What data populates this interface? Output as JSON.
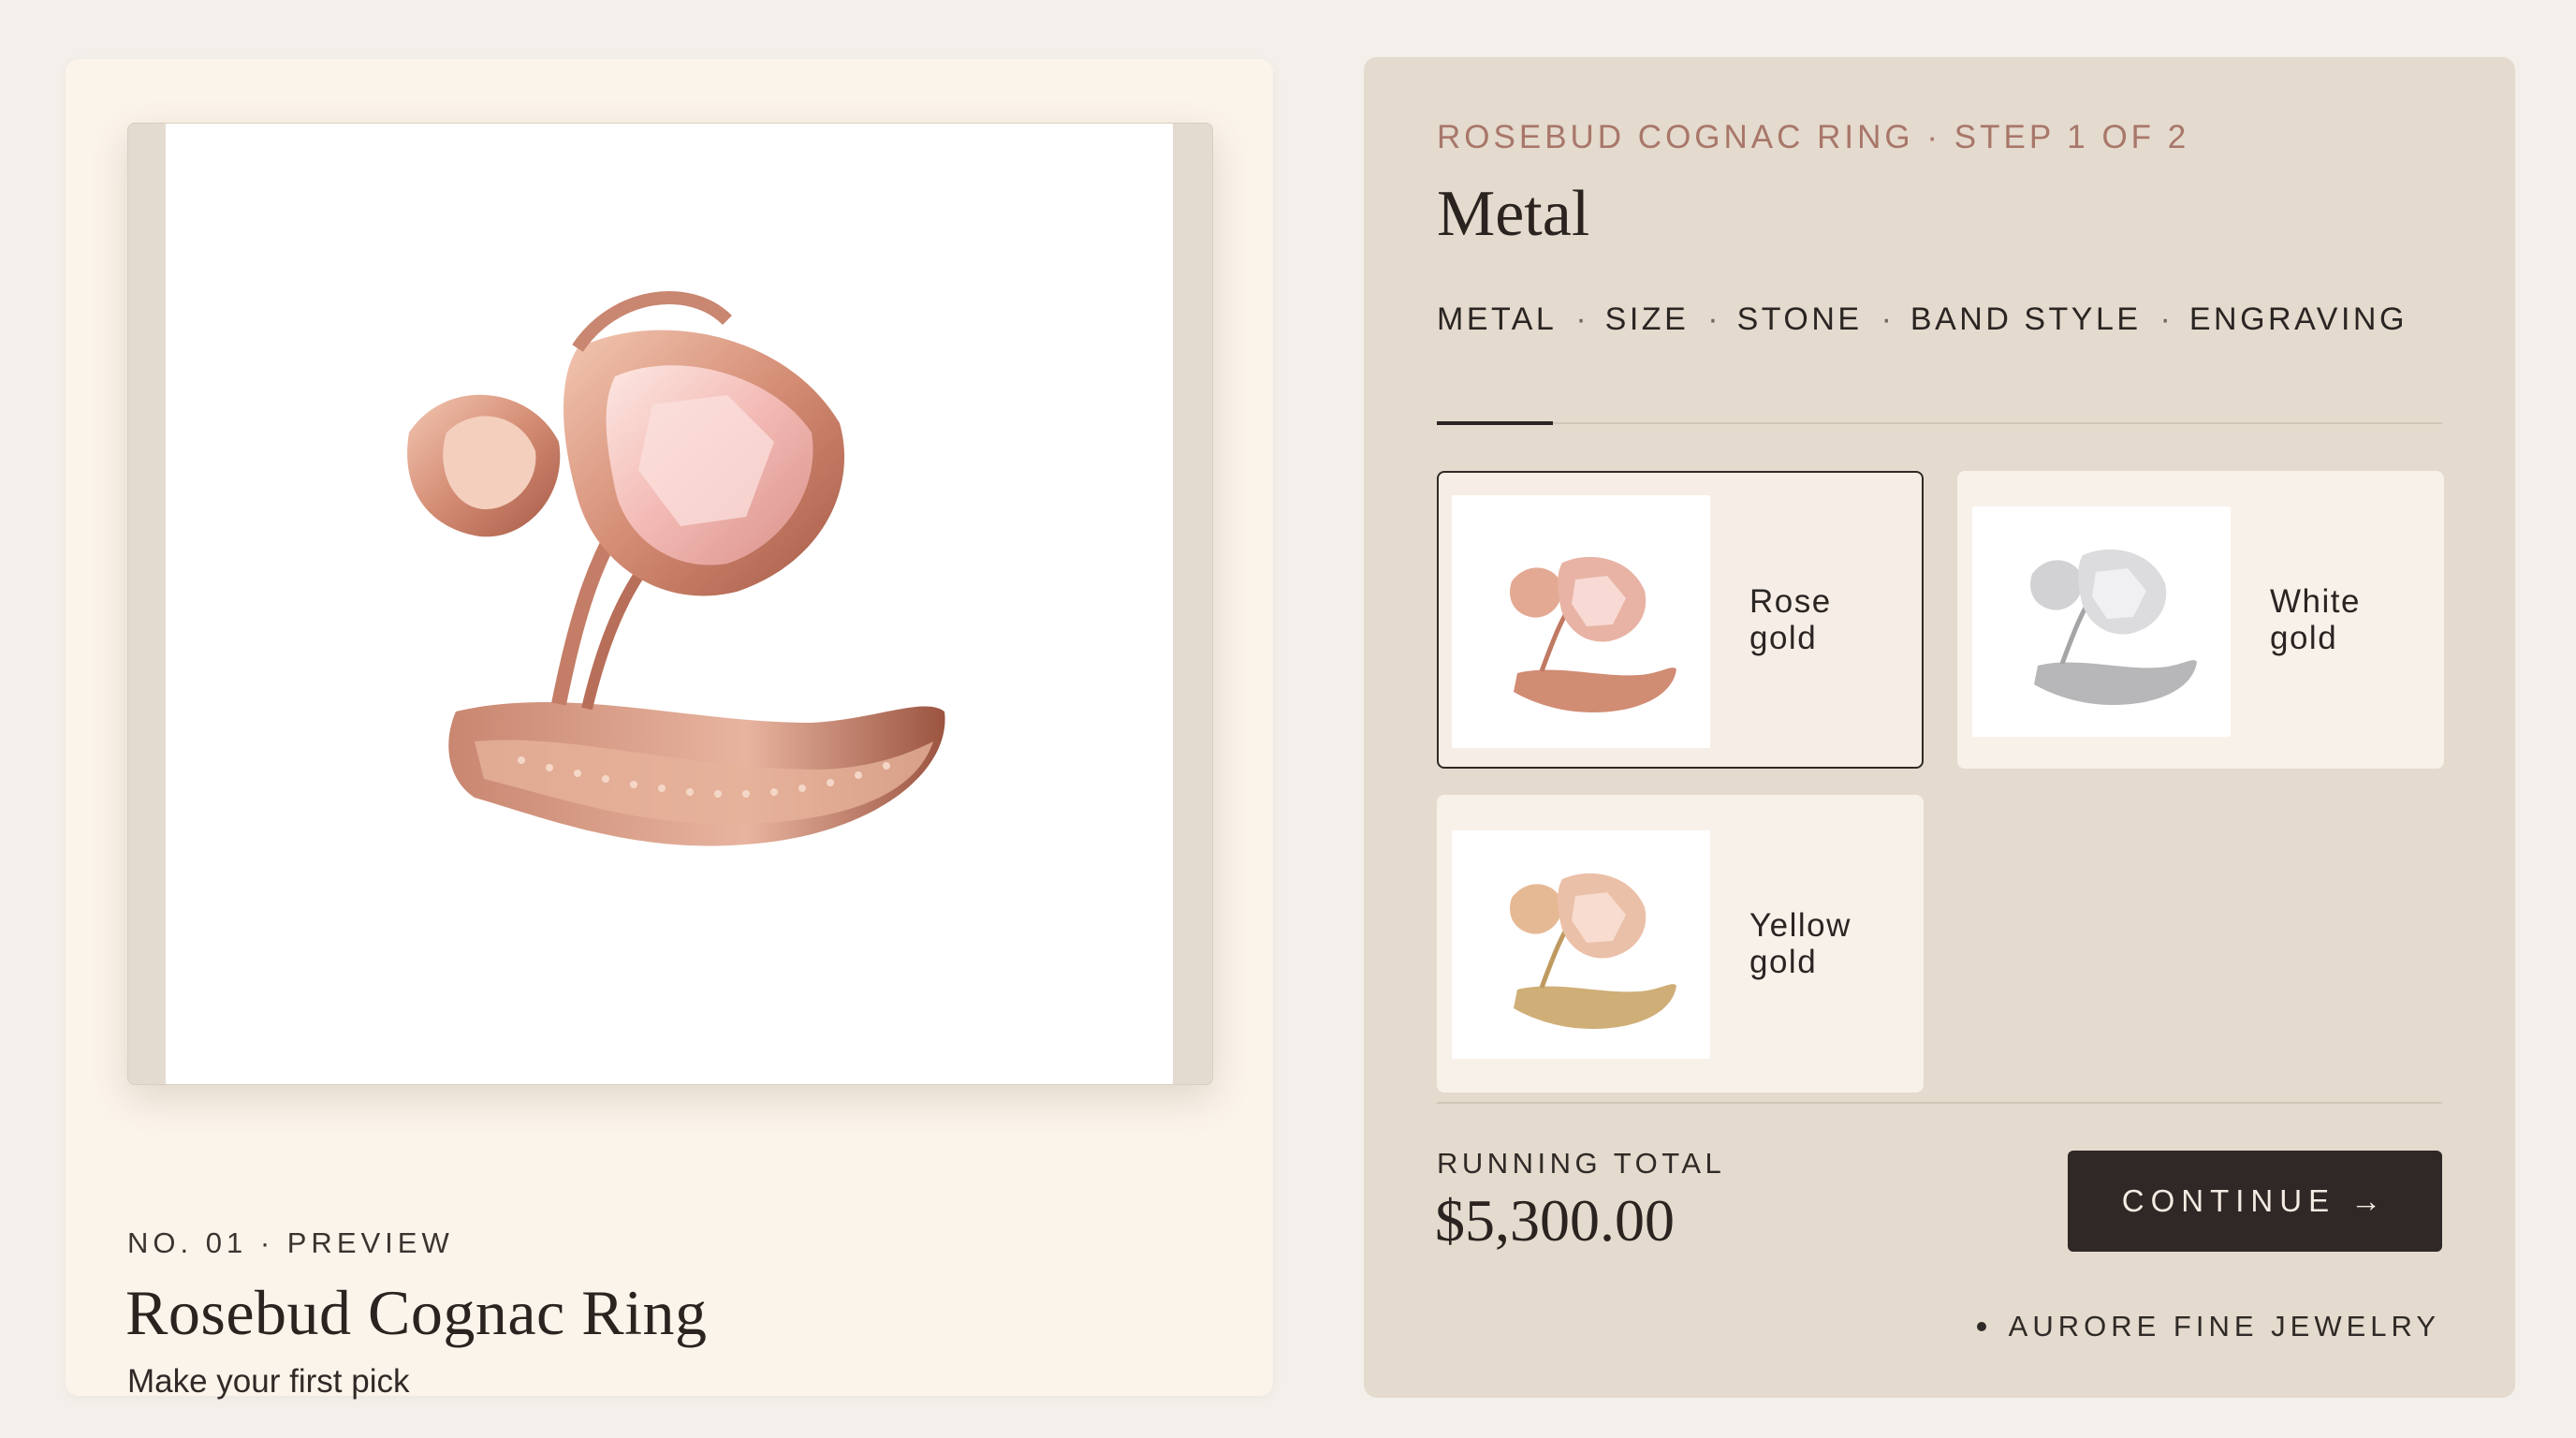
{
  "preview": {
    "eyebrow": "NO. 01 · PREVIEW",
    "title": "Rosebud Cognac Ring",
    "subtitle": "Make your first pick",
    "image": "rose-gold-ring-photo"
  },
  "configurator": {
    "eyebrow": "ROSEBUD COGNAC RING · STEP 1 OF 2",
    "step_title": "Metal",
    "tabs": [
      {
        "label": "METAL",
        "active": true
      },
      {
        "label": "SIZE",
        "active": false
      },
      {
        "label": "STONE",
        "active": false
      },
      {
        "label": "BAND STYLE",
        "active": false
      },
      {
        "label": "ENGRAVING",
        "active": false
      }
    ],
    "tab_separator": "·",
    "options": [
      {
        "label": "Rose gold",
        "selected": true,
        "color": "#d9967e"
      },
      {
        "label": "White gold",
        "selected": false,
        "color": "#bfbfc2"
      },
      {
        "label": "Yellow gold",
        "selected": false,
        "color": "#d4b07a"
      }
    ]
  },
  "footer": {
    "total_label": "RUNNING TOTAL",
    "total_value": "$5,300.00",
    "continue_label": "CONTINUE →",
    "brand": "AURORE FINE JEWELRY"
  },
  "colors": {
    "accent_eyebrow": "#a8776a",
    "button": "#2f2826",
    "panel": "#e4dacd",
    "card": "#fbf4ea"
  }
}
